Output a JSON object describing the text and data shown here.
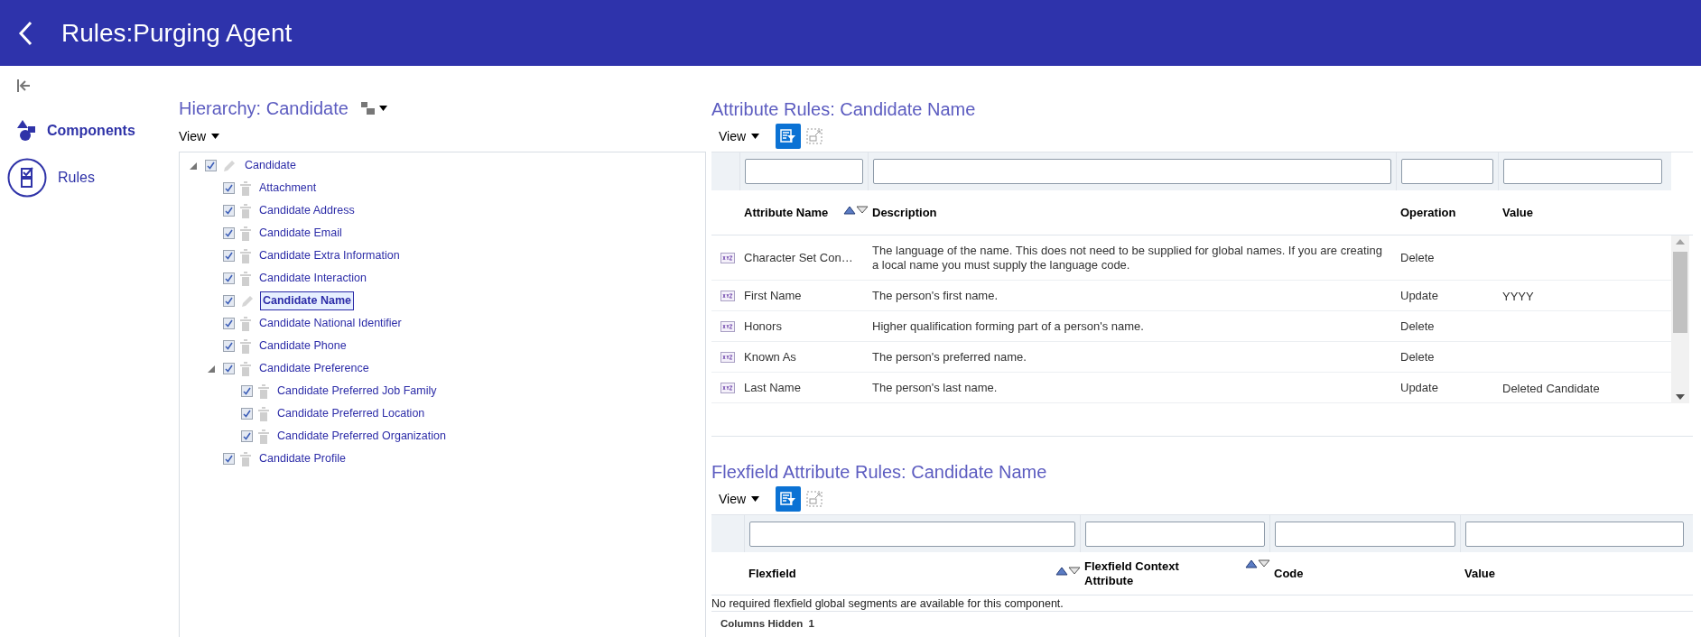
{
  "header": {
    "title": "Rules:Purging Agent"
  },
  "sidebar": {
    "items": [
      {
        "label": "Components",
        "kind": "shapes",
        "selected": false
      },
      {
        "label": "Rules",
        "kind": "checklist",
        "selected": true
      }
    ]
  },
  "hierarchy": {
    "title": "Hierarchy: Candidate",
    "view_label": "View",
    "tree": [
      {
        "label": "Candidate",
        "kind": "edit",
        "checked": true,
        "selected": false,
        "expanded": true,
        "children": [
          {
            "label": "Attachment",
            "kind": "delete",
            "checked": true,
            "selected": false
          },
          {
            "label": "Candidate Address",
            "kind": "delete",
            "checked": true,
            "selected": false
          },
          {
            "label": "Candidate Email",
            "kind": "delete",
            "checked": true,
            "selected": false
          },
          {
            "label": "Candidate Extra Information",
            "kind": "delete",
            "checked": true,
            "selected": false
          },
          {
            "label": "Candidate Interaction",
            "kind": "delete",
            "checked": true,
            "selected": false
          },
          {
            "label": "Candidate Name",
            "kind": "edit",
            "checked": true,
            "selected": true
          },
          {
            "label": "Candidate National Identifier",
            "kind": "delete",
            "checked": true,
            "selected": false
          },
          {
            "label": "Candidate Phone",
            "kind": "delete",
            "checked": true,
            "selected": false
          },
          {
            "label": "Candidate Preference",
            "kind": "delete",
            "checked": true,
            "selected": false,
            "expanded": true,
            "children": [
              {
                "label": "Candidate Preferred Job Family",
                "kind": "delete",
                "checked": true,
                "selected": false
              },
              {
                "label": "Candidate Preferred Location",
                "kind": "delete",
                "checked": true,
                "selected": false
              },
              {
                "label": "Candidate Preferred Organization",
                "kind": "delete",
                "checked": true,
                "selected": false
              }
            ]
          },
          {
            "label": "Candidate Profile",
            "kind": "delete",
            "checked": true,
            "selected": false
          }
        ]
      }
    ]
  },
  "attribute_rules": {
    "title": "Attribute Rules: Candidate Name",
    "view_label": "View",
    "columns": [
      {
        "label": "Attribute Name",
        "sortable": true
      },
      {
        "label": "Description",
        "sortable": false
      },
      {
        "label": "Operation",
        "sortable": false
      },
      {
        "label": "Value",
        "sortable": false
      }
    ],
    "rows": [
      {
        "attribute_name": "Character Set Con…",
        "description": "The language of the name. This does not need to be supplied for global names. If you are creating a local name you must supply the language code.",
        "operation": "Delete"
      },
      {
        "attribute_name": "First Name",
        "description": "The person's first name.",
        "operation": "Update",
        "value": "YYYY"
      },
      {
        "attribute_name": "Honors",
        "description": "Higher qualification forming part of a person's name.",
        "operation": "Delete"
      },
      {
        "attribute_name": "Known As",
        "description": "The person's preferred name.",
        "operation": "Delete"
      },
      {
        "attribute_name": "Last Name",
        "description": "The person's last name.",
        "operation": "Update",
        "value": "Deleted Candidate"
      }
    ]
  },
  "flexfield_rules": {
    "title": "Flexfield Attribute Rules: Candidate Name",
    "view_label": "View",
    "columns": [
      {
        "label": "Flexfield",
        "sortable": true
      },
      {
        "label": "Flexfield Context Attribute",
        "sortable": true
      },
      {
        "label": "Code",
        "sortable": false
      },
      {
        "label": "Value",
        "sortable": false
      }
    ],
    "message": "No required flexfield global segments are available for this component.",
    "footer": {
      "label": "Columns Hidden",
      "count": "1"
    }
  }
}
